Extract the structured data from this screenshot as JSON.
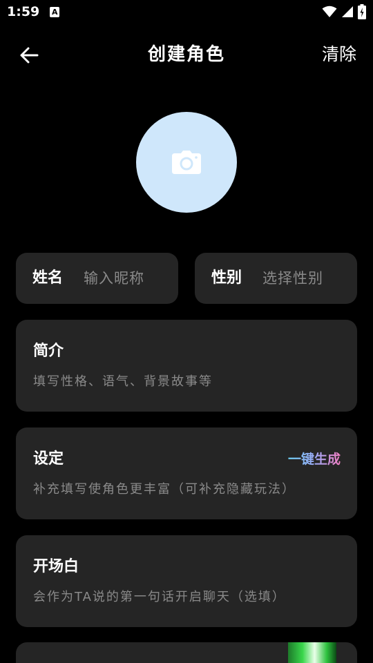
{
  "status_bar": {
    "time": "1:59",
    "notification_glyph": "A",
    "icons": [
      "wifi-icon",
      "signal-icon",
      "battery-charging-icon"
    ]
  },
  "header": {
    "back_icon": "arrow-left-icon",
    "title": "创建角色",
    "clear_label": "清除"
  },
  "avatar": {
    "icon": "camera-icon",
    "background": "#cfe7fb"
  },
  "name_field": {
    "label": "姓名",
    "placeholder": "输入昵称"
  },
  "gender_field": {
    "label": "性别",
    "placeholder": "选择性别"
  },
  "intro": {
    "title": "简介",
    "hint": "填写性格、语气、背景故事等"
  },
  "setting": {
    "title": "设定",
    "generate_label": "一键生成",
    "hint": "补充填写使角色更丰富（可补充隐藏玩法）"
  },
  "opening": {
    "title": "开场白",
    "hint": "会作为TA说的第一句话开启聊天（选填）"
  },
  "colors": {
    "background": "#000000",
    "card": "#252525",
    "hint_text": "#8a8a8a",
    "gradient": [
      "#6fd0f5",
      "#9aa9f5",
      "#f27fc4"
    ]
  }
}
